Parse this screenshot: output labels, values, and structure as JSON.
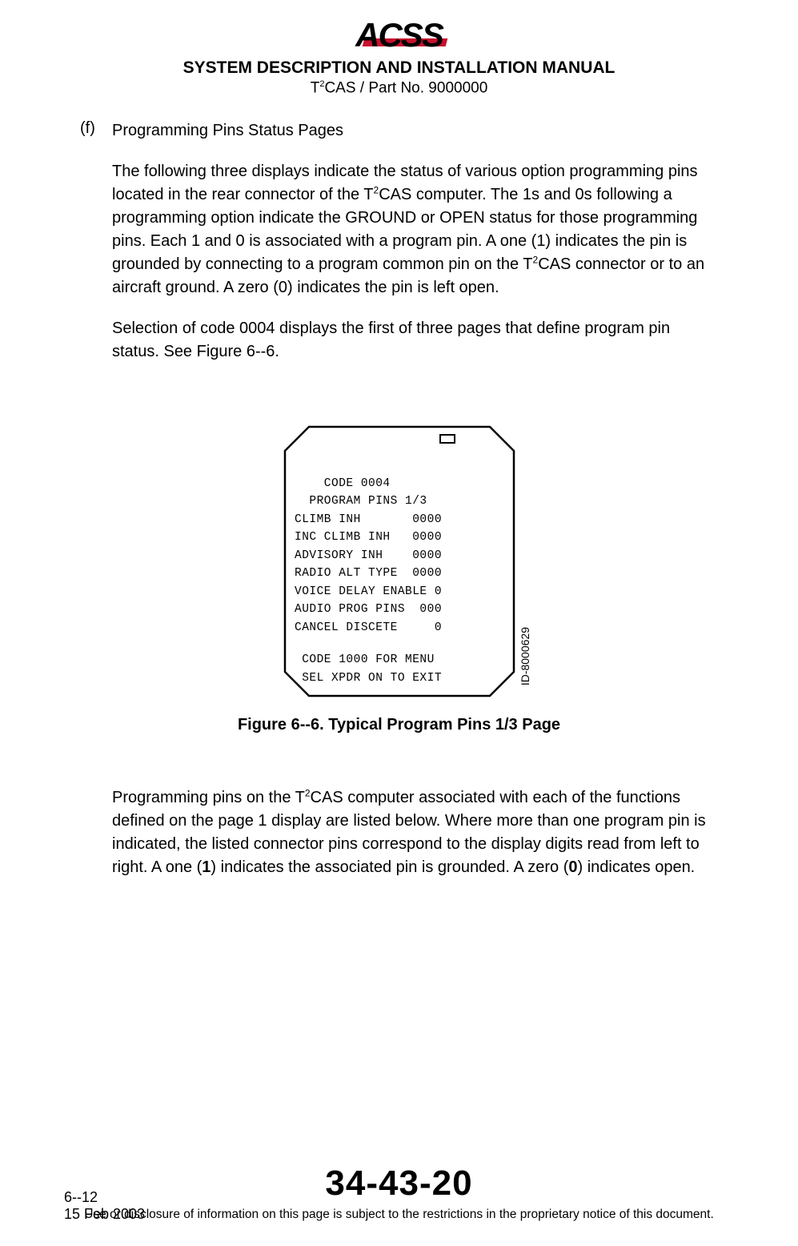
{
  "logo_text": "ACSS",
  "manual_title": "SYSTEM DESCRIPTION AND INSTALLATION MANUAL",
  "manual_subtitle_pre": "T",
  "manual_subtitle_sup": "2",
  "manual_subtitle_post": "CAS / Part No. 9000000",
  "section_label": "(f)",
  "section_title": "Programming Pins Status Pages",
  "para1_a": "The following three displays indicate the status of various option programming pins located in the rear connector of the T",
  "para1_sup": "2",
  "para1_b": "CAS computer.  The 1s and 0s following a programming option indicate the GROUND or OPEN status for those programming pins.  Each 1 and 0 is associated with a program pin.  A one (1) indicates the pin is grounded by connecting to a program common pin on the T",
  "para1_sup2": "2",
  "para1_c": "CAS connector or to an aircraft ground.  A zero (0) indicates the pin is left open.",
  "para2": "Selection of code 0004 displays the first of three pages that define program pin status.  See Figure 6--6.",
  "display": {
    "line1": "    CODE 0004",
    "line2": "  PROGRAM PINS 1/3",
    "line3": "CLIMB INH       0000",
    "line4": "INC CLIMB INH   0000",
    "line5": "ADVISORY INH    0000",
    "line6": "RADIO ALT TYPE  0000",
    "line7": "VOICE DELAY ENABLE 0",
    "line8": "AUDIO PROG PINS  000",
    "line9": "CANCEL DISCETE     0",
    "foot1": " CODE 1000 FOR MENU",
    "foot2": " SEL XPDR ON TO EXIT"
  },
  "figure_id": "ID-8000629",
  "figure_caption": "Figure 6--6.  Typical Program Pins 1/3 Page",
  "para3_a": "Programming pins on the T",
  "para3_sup": "2",
  "para3_b": "CAS computer associated with each of the functions defined on the page 1 display are listed below.  Where more than one program pin is indicated, the listed connector pins correspond to the display digits read from left to right.  A one (",
  "para3_bold1": "1",
  "para3_c": ") indicates the associated pin is grounded.  A zero (",
  "para3_bold2": "0",
  "para3_d": ") indicates open.",
  "footer_page_seq": "6--12",
  "footer_date": "15 Feb 2003",
  "footer_pageno": "34-43-20",
  "footer_notice": "Use or disclosure of information on this page is subject to the restrictions in the proprietary notice of this document."
}
